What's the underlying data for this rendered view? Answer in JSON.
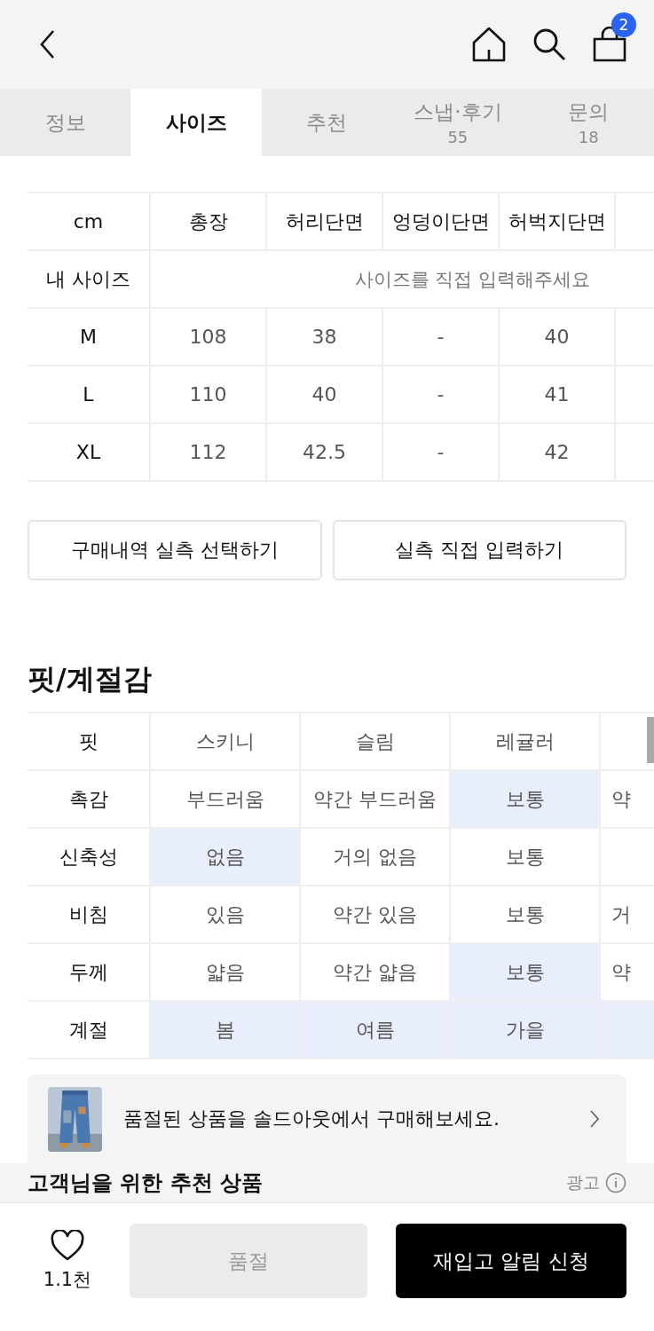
{
  "header": {
    "cart_count": "2"
  },
  "tabs": [
    {
      "label": "정보",
      "selected": false
    },
    {
      "label": "사이즈",
      "selected": true
    },
    {
      "label": "추천",
      "selected": false
    },
    {
      "label": "스냅·후기",
      "count": "55",
      "selected": false
    },
    {
      "label": "문의",
      "count": "18",
      "selected": false
    }
  ],
  "size_table": {
    "columns": [
      "cm",
      "총장",
      "허리단면",
      "엉덩이단면",
      "허벅지단면"
    ],
    "my_size": {
      "label": "내 사이즈",
      "placeholder": "사이즈를 직접 입력해주세요"
    },
    "rows": [
      [
        "M",
        "108",
        "38",
        "-",
        "40"
      ],
      [
        "L",
        "110",
        "40",
        "-",
        "41"
      ],
      [
        "XL",
        "112",
        "42.5",
        "-",
        "42"
      ]
    ]
  },
  "size_buttons": [
    "구매내역 실측 선택하기",
    "실측 직접 입력하기"
  ],
  "fit_section": {
    "title": "핏/계절감",
    "rows": [
      {
        "label": "핏",
        "kind": "bar",
        "options": [
          {
            "text": "스키니",
            "selected": false
          },
          {
            "text": "슬림",
            "selected": false
          },
          {
            "text": "레귤러",
            "selected": false
          },
          {
            "selected": true
          }
        ]
      },
      {
        "label": "촉감",
        "kind": "fill",
        "options": [
          {
            "text": "부드러움",
            "selected": false
          },
          {
            "text": "약간 부드러움",
            "selected": false
          },
          {
            "text": "보통",
            "selected": true
          },
          {
            "text": "약",
            "selected": false
          }
        ]
      },
      {
        "label": "신축성",
        "kind": "fill",
        "options": [
          {
            "text": "없음",
            "selected": true
          },
          {
            "text": "거의 없음",
            "selected": false
          },
          {
            "text": "보통",
            "selected": false
          }
        ]
      },
      {
        "label": "비침",
        "kind": "fill",
        "options": [
          {
            "text": "있음",
            "selected": false
          },
          {
            "text": "약간 있음",
            "selected": false
          },
          {
            "text": "보통",
            "selected": false
          },
          {
            "text": "거",
            "selected": false
          }
        ]
      },
      {
        "label": "두께",
        "kind": "fill",
        "options": [
          {
            "text": "얇음",
            "selected": false
          },
          {
            "text": "약간 얇음",
            "selected": false
          },
          {
            "text": "보통",
            "selected": true
          },
          {
            "text": "약",
            "selected": false
          }
        ]
      },
      {
        "label": "계절",
        "kind": "fill",
        "options": [
          {
            "text": "봄",
            "selected": true
          },
          {
            "text": "여름",
            "selected": true
          },
          {
            "text": "가을",
            "selected": true
          },
          {
            "selected": true
          }
        ]
      }
    ]
  },
  "soldout_banner": {
    "text": "품절된 상품을 솔드아웃에서 구매해보세요."
  },
  "recommend": {
    "title": "고객님을 위한 추천 상품",
    "ad_label": "광고"
  },
  "bottom_bar": {
    "like_count": "1.1천",
    "soldout_button": {
      "label": "품절",
      "disabled": true
    },
    "restock_button": "재입고 알림 신청"
  }
}
